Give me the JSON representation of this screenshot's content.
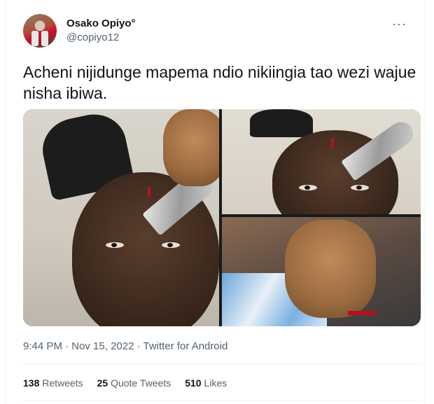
{
  "author": {
    "name": "Osako Opiyo°",
    "handle": "@copiyo12"
  },
  "menu_glyph": "···",
  "tweet": {
    "text": "Acheni nijidunge mapema ndio nikiingia tao wezi wajue nisha ibiwa."
  },
  "meta": {
    "time": "9:44 PM",
    "sep1": " · ",
    "date": "Nov 15, 2022",
    "sep2": " · ",
    "source": "Twitter for Android"
  },
  "stats": {
    "retweets_count": "138",
    "retweets_label": "Retweets",
    "quotes_count": "25",
    "quotes_label": "Quote Tweets",
    "likes_count": "510",
    "likes_label": "Likes"
  },
  "colors": {
    "text": "#0f1419",
    "secondary": "#536471",
    "divider": "#eff3f4"
  }
}
